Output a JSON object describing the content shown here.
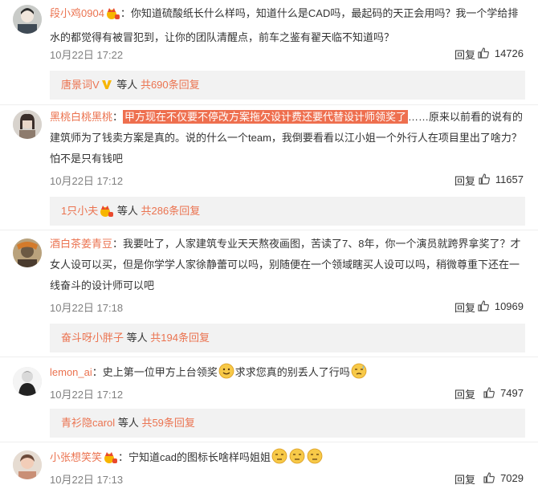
{
  "comments": [
    {
      "username": "段小鸡0904",
      "text_1": "：你知道硫酸纸长什么样吗，知道什么是CAD吗，最起码的天正会用吗？我一个学给排水的都觉得有被冒犯到，让你的团队清醒点，前车之鉴有翟天临不知道吗？",
      "time": "10月22日 17:22",
      "reply": "回复",
      "likes": "14726",
      "sub_user": "唐景词V",
      "sub_mid": "等人",
      "sub_count": "共690条回复"
    },
    {
      "username": "黑桃白桃黑桃",
      "text_pre": "：",
      "highlight": "甲方现在不仅要不停改方案拖欠设计费还要代替设计师领奖了",
      "text_post": "……原来以前看的说有的建筑师为了钱卖方案是真的。说的什么一个team，我倒要看看以江小姐一个外行人在项目里出了啥力？怕不是只有钱吧",
      "time": "10月22日 17:12",
      "reply": "回复",
      "likes": "11657",
      "sub_user": "1只小夫",
      "sub_mid": "等人",
      "sub_count": "共286条回复"
    },
    {
      "username": "酒白茶姜青豆",
      "text_1": "：我要吐了，人家建筑专业天天熬夜画图，苦读了7、8年，你一个演员就跨界拿奖了？才女人设可以买，但是你学学人家徐静蕾可以吗，别随便在一个领域瞎买人设可以吗，稍微尊重下还在一线奋斗的设计师可以吧",
      "time": "10月22日 17:18",
      "reply": "回复",
      "likes": "10969",
      "sub_user": "奋斗呀小胖子",
      "sub_mid": "等人",
      "sub_count": "共194条回复"
    },
    {
      "username": "lemon_ai",
      "text_1": "：史上第一位甲方上台领奖",
      "text_2": "求求您真的别丢人了行吗",
      "time": "10月22日 17:12",
      "reply": "回复",
      "likes": "7497",
      "sub_user": "青衫隐carol",
      "sub_mid": "等人",
      "sub_count": "共59条回复"
    },
    {
      "username": "小张想笑笑",
      "text_1": "：宁知道cad的图标长啥样吗姐姐",
      "time": "10月22日 17:13",
      "reply": "回复",
      "likes": "7029"
    }
  ]
}
